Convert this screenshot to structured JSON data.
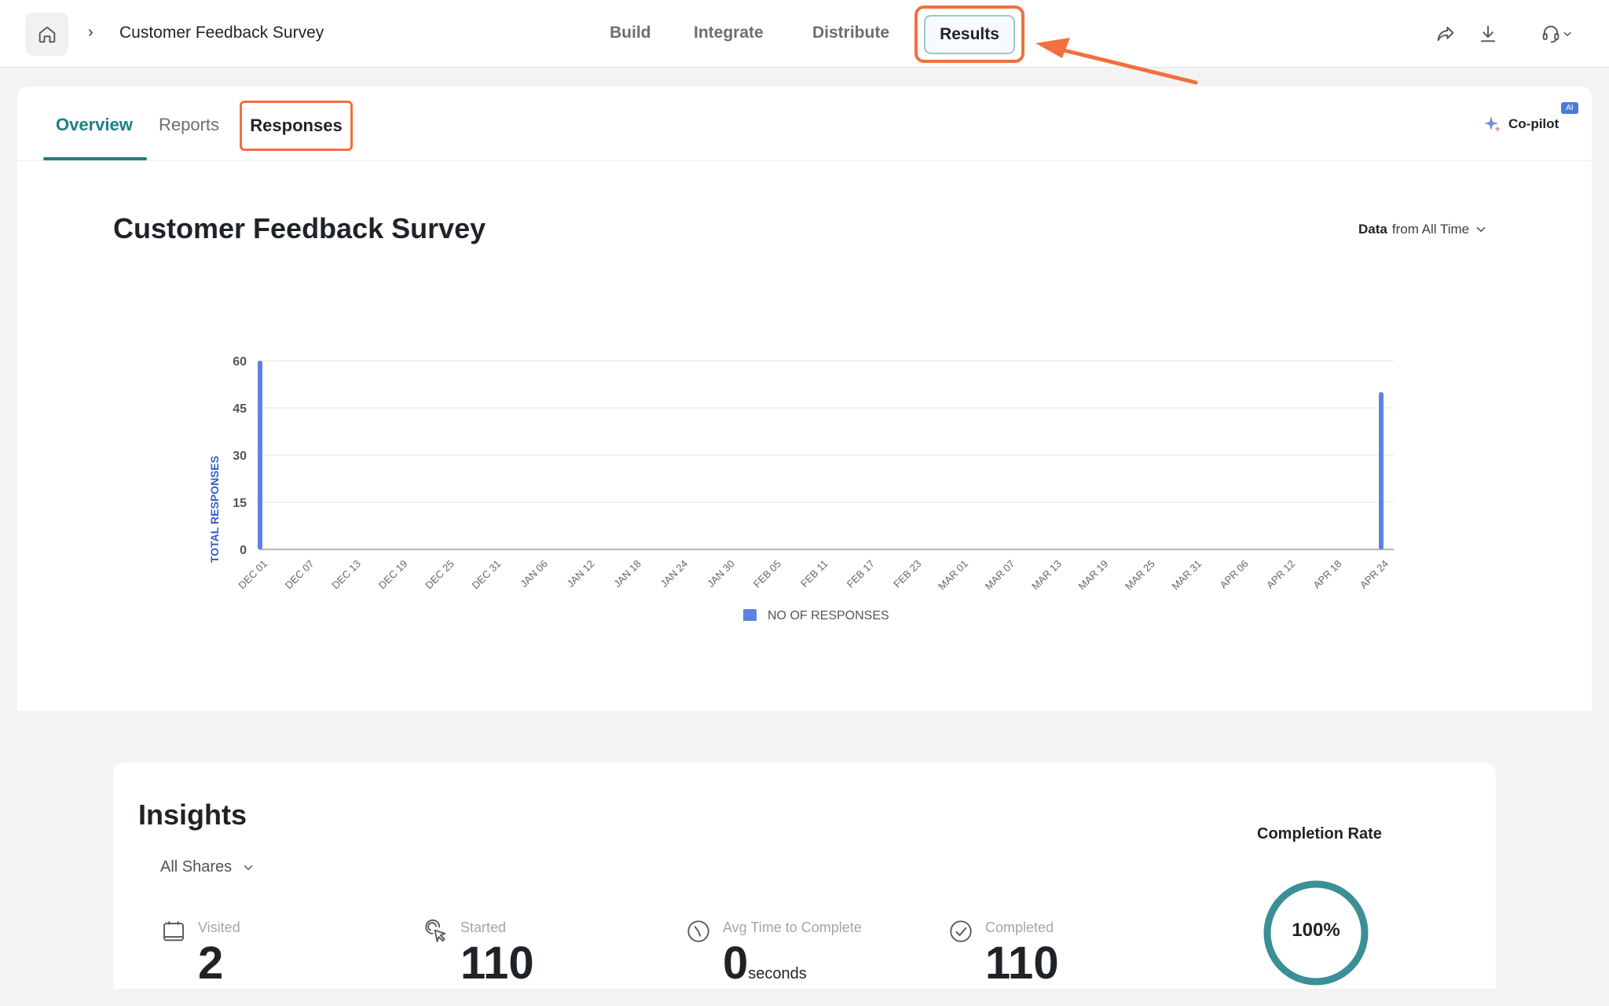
{
  "header": {
    "breadcrumb_separator": "›",
    "survey_name": "Customer Feedback Survey",
    "nav": {
      "build": "Build",
      "integrate": "Integrate",
      "distribute": "Distribute",
      "results": "Results"
    },
    "icons": [
      "home-icon",
      "share-icon",
      "download-icon",
      "headset-icon",
      "chevron-down-icon"
    ]
  },
  "subtabs": {
    "overview": "Overview",
    "reports": "Reports",
    "responses": "Responses",
    "copilot": "Co-pilot",
    "ai_badge": "AI"
  },
  "main": {
    "title": "Customer Feedback Survey",
    "filter_label": "Data",
    "filter_value": "from All Time"
  },
  "chart_data": {
    "type": "bar",
    "categories": [
      "DEC 01",
      "DEC 07",
      "DEC 13",
      "DEC 19",
      "DEC 25",
      "DEC 31",
      "JAN 06",
      "JAN 12",
      "JAN 18",
      "JAN 24",
      "JAN 30",
      "FEB 05",
      "FEB 11",
      "FEB 17",
      "FEB 23",
      "MAR 01",
      "MAR 07",
      "MAR 13",
      "MAR 19",
      "MAR 25",
      "MAR 31",
      "APR 06",
      "APR 12",
      "APR 18",
      "APR 24"
    ],
    "series": [
      {
        "name": "NO OF RESPONSES",
        "values": [
          60,
          0,
          0,
          0,
          0,
          0,
          0,
          0,
          0,
          0,
          0,
          0,
          0,
          0,
          0,
          0,
          0,
          0,
          0,
          0,
          0,
          0,
          0,
          0,
          50
        ]
      }
    ],
    "yticks": [
      "0",
      "15",
      "30",
      "45",
      "60"
    ],
    "ylim": [
      0,
      60
    ],
    "ylabel": "TOTAL RESPONSES",
    "xlabel": "",
    "legend_position": "bottom",
    "grid": true,
    "bar_color": "#5b84e0"
  },
  "insights": {
    "title": "Insights",
    "shares_filter": "All Shares",
    "metrics": [
      {
        "label": "Visited",
        "value": "2",
        "unit": "",
        "icon": "calendar-icon"
      },
      {
        "label": "Started",
        "value": "110",
        "unit": "",
        "icon": "cursor-click-icon"
      },
      {
        "label": "Avg Time to Complete",
        "value": "0",
        "unit": "seconds",
        "icon": "clock-icon"
      },
      {
        "label": "Completed",
        "value": "110",
        "unit": "",
        "icon": "check-circle-icon"
      }
    ],
    "completion_label": "Completion Rate",
    "completion_rate": "100%",
    "completion_fraction": 1.0
  },
  "colors": {
    "accent_teal": "#1d7f86",
    "highlight_orange": "#f26f3e",
    "donut_ring": "#3b8f96"
  }
}
